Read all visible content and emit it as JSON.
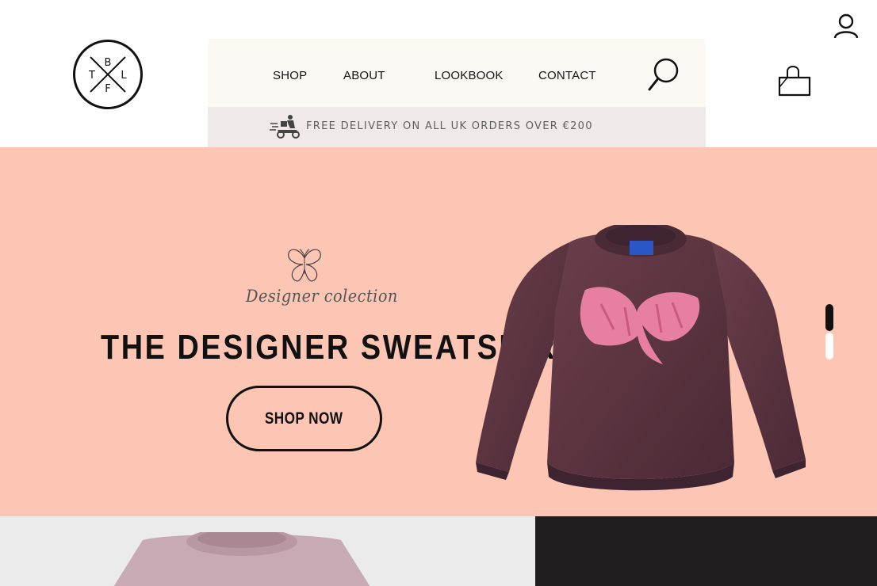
{
  "header": {
    "logo_letters": {
      "top": "B",
      "left": "T",
      "right": "L",
      "bottom": "F"
    },
    "nav": [
      {
        "label": "SHOP"
      },
      {
        "label": "ABOUT"
      },
      {
        "label": "LOOKBOOK"
      },
      {
        "label": "CONTACT"
      }
    ],
    "icons": {
      "search": "search-icon",
      "user": "user-icon",
      "cart": "shopping-bag-icon",
      "delivery": "delivery-scooter-icon"
    },
    "delivery_text": "FREE DELIVERY ON ALL UK ORDERS OVER €200"
  },
  "hero": {
    "subtitle": "Designer colection",
    "title": "THE DESIGNER SWEATSHIRT",
    "cta_label": "SHOP NOW",
    "carousel": {
      "total_slides": 2,
      "active_slide": 1
    }
  },
  "colors": {
    "hero_bg": "#fdc6b4",
    "nav_bg": "#fcf8f4",
    "delivery_bg": "#f0e9e9",
    "sweater": "#5b3440",
    "bow": "#e77fa2",
    "dark_panel": "#201e1f",
    "light_panel": "#ebebeb"
  }
}
